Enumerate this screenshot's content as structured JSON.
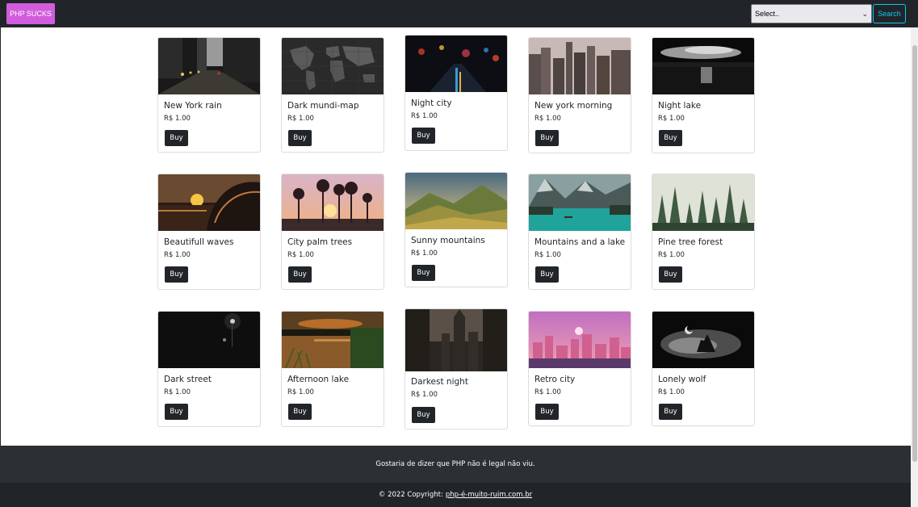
{
  "navbar": {
    "brand": "PHP SUCKS",
    "select_value": "Select..",
    "search_label": "Search",
    "brand_color": "#d15ddd",
    "search_color": "#0dcaf0"
  },
  "products": [
    {
      "title": "New York rain",
      "price": "R$ 1.00",
      "buy": "Buy",
      "image": "new-york-rain-image"
    },
    {
      "title": "Dark mundi-map",
      "price": "R$ 1.00",
      "buy": "Buy",
      "image": "dark-world-map-image"
    },
    {
      "title": "Night city",
      "price": "R$ 1.00",
      "buy": "Buy",
      "image": "night-city-image"
    },
    {
      "title": "New york morning",
      "price": "R$ 1.00",
      "buy": "Buy",
      "image": "new-york-morning-image"
    },
    {
      "title": "Night lake",
      "price": "R$ 1.00",
      "buy": "Buy",
      "image": "night-lake-image"
    },
    {
      "title": "Beautifull waves",
      "price": "R$ 1.00",
      "buy": "Buy",
      "image": "waves-sunset-image"
    },
    {
      "title": "City palm trees",
      "price": "R$ 1.00",
      "buy": "Buy",
      "image": "palm-trees-image"
    },
    {
      "title": "Sunny mountains",
      "price": "R$ 1.00",
      "buy": "Buy",
      "image": "sunny-mountains-image"
    },
    {
      "title": "Mountains and a lake",
      "price": "R$ 1.00",
      "buy": "Buy",
      "image": "mountain-lake-image"
    },
    {
      "title": "Pine tree forest",
      "price": "R$ 1.00",
      "buy": "Buy",
      "image": "pine-forest-image"
    },
    {
      "title": "Dark street",
      "price": "R$ 1.00",
      "buy": "Buy",
      "image": "dark-street-image"
    },
    {
      "title": "Afternoon lake",
      "price": "R$ 1.00",
      "buy": "Buy",
      "image": "afternoon-lake-image"
    },
    {
      "title": "Darkest night",
      "price": "R$ 1.00",
      "buy": "Buy",
      "image": "gothic-city-image"
    },
    {
      "title": "Retro city",
      "price": "R$ 1.00",
      "buy": "Buy",
      "image": "retro-city-image"
    },
    {
      "title": "Lonely wolf",
      "price": "R$ 1.00",
      "buy": "Buy",
      "image": "lonely-wolf-image"
    }
  ],
  "footer": {
    "message": "Gostaria de dizer que PHP não é legal não viu.",
    "copyright": "© 2022 Copyright:",
    "link": "php-é-muito-ruim.com.br"
  }
}
